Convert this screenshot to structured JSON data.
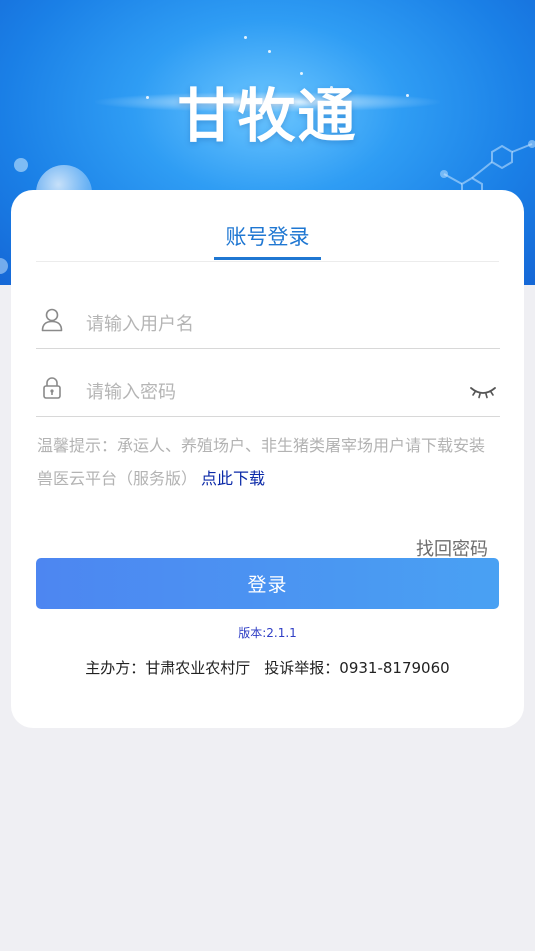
{
  "header": {
    "app_title": "甘牧通"
  },
  "login_tabs": {
    "active_tab": "账号登录"
  },
  "form": {
    "username_placeholder": "请输入用户名",
    "username_value": "",
    "password_placeholder": "请输入密码",
    "password_value": ""
  },
  "tip": {
    "text": "温馨提示：承运人、养殖场户、非生猪类屠宰场用户请下载安装兽医云平台（服务版）",
    "link_label": "点此下载"
  },
  "actions": {
    "find_password_label": "找回密码",
    "login_label": "登录"
  },
  "footer": {
    "version": "版本:2.1.1",
    "sponsor": "主办方：甘肃农业农村厅",
    "complaint": "投诉举报：0931-8179060"
  },
  "icons": {
    "username": "user-icon",
    "password": "lock-icon",
    "visibility": "eye-closed-icon"
  },
  "colors": {
    "accent": "#1f77d2",
    "button_start": "#4d86f1",
    "button_end": "#49a1f3",
    "link": "#0c2aa8",
    "version": "#2f3ec5"
  }
}
